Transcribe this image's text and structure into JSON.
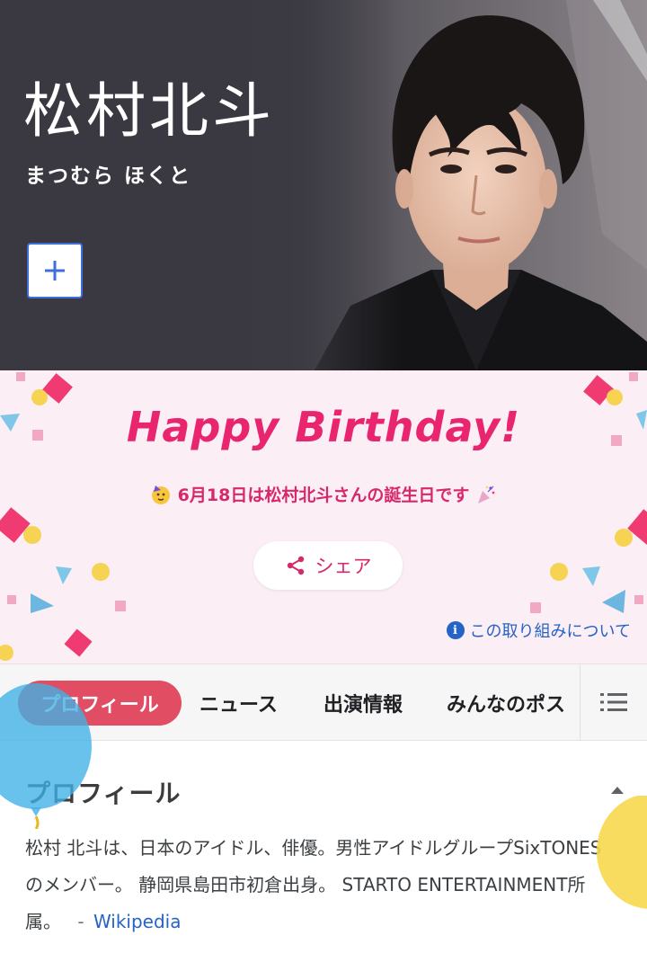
{
  "hero": {
    "name": "松村北斗",
    "kana": "まつむら ほくと",
    "follow_button": "+"
  },
  "birthday": {
    "title": "Happy Birthday!",
    "message": "6月18日は松村北斗さんの誕生日です",
    "share_label": "シェア",
    "about_label": "この取り組みについて"
  },
  "tabs": [
    "プロフィール",
    "ニュース",
    "出演情報",
    "みんなのポス"
  ],
  "profile": {
    "heading": "プロフィール",
    "description": "松村 北斗は、日本のアイドル、俳優。男性アイドルグループSixTONESのメンバー。 静岡県島田市初倉出身。 STARTO ENTERTAINMENT所属。",
    "source_separator": "-",
    "source_link": "Wikipedia"
  },
  "colors": {
    "accent_pink": "#e8256e",
    "tab_active": "#e14d63",
    "link_blue": "#2563c6",
    "birthday_bg": "#fbeef5"
  },
  "icons": {
    "follow": "plus-icon",
    "share": "share-icon",
    "info": "info-icon",
    "menu": "list-menu-icon",
    "collapse": "chevron-up-icon"
  }
}
